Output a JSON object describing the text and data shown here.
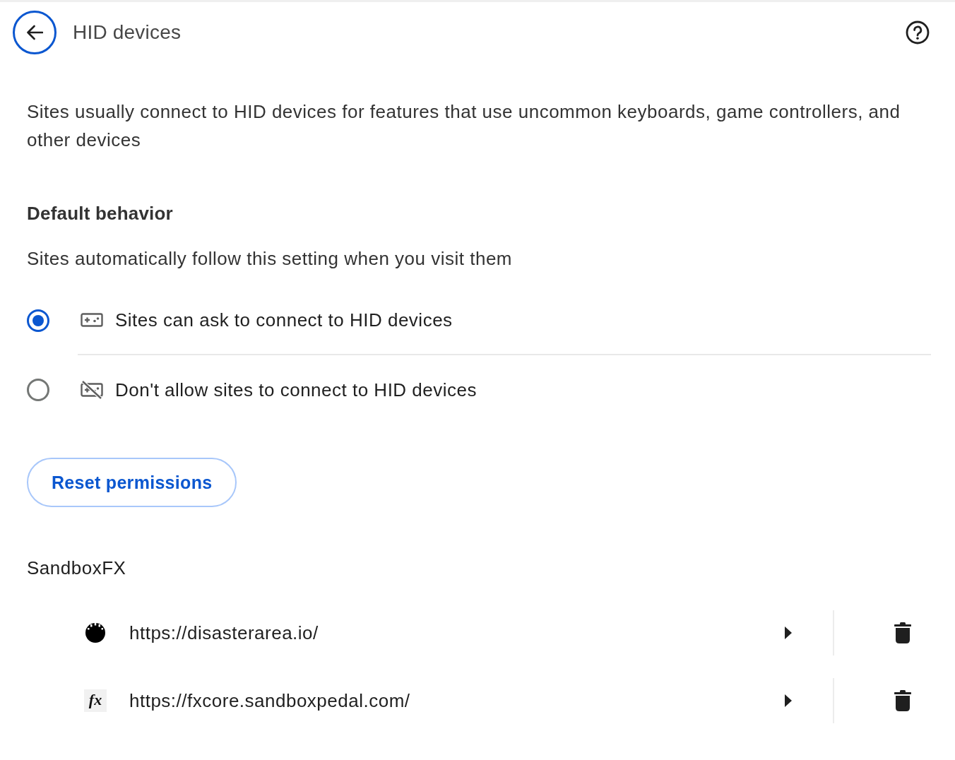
{
  "header": {
    "title": "HID devices"
  },
  "description": "Sites usually connect to HID devices for features that use uncommon keyboards, game controllers, and other devices",
  "default_behavior": {
    "heading": "Default behavior",
    "subtitle": "Sites automatically follow this setting when you visit them",
    "options": [
      {
        "kind": "allow",
        "label": "Sites can ask to connect to HID devices",
        "selected": true
      },
      {
        "kind": "block",
        "label": "Don't allow sites to connect to HID devices",
        "selected": false
      }
    ]
  },
  "reset_button": "Reset permissions",
  "groups": [
    {
      "name": "SandboxFX",
      "sites": [
        {
          "url": "https://disasterarea.io/",
          "favicon": {
            "kind": "dial"
          }
        },
        {
          "url": "https://fxcore.sandboxpedal.com/",
          "favicon": {
            "kind": "text",
            "text": "fx"
          }
        }
      ]
    }
  ]
}
